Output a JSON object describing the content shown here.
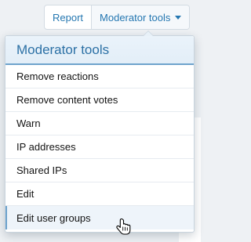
{
  "toolbar": {
    "report_label": "Report",
    "moderator_tools_label": "Moderator tools"
  },
  "menu": {
    "title": "Moderator tools",
    "items": [
      {
        "label": "Remove reactions"
      },
      {
        "label": "Remove content votes"
      },
      {
        "label": "Warn"
      },
      {
        "label": "IP addresses"
      },
      {
        "label": "Shared IPs"
      },
      {
        "label": "Edit"
      },
      {
        "label": "Edit user groups",
        "hovered": true
      }
    ]
  },
  "colors": {
    "accent": "#2577b1",
    "header_text": "#2b70a5",
    "header_bg": "#e3eef8",
    "header_border": "#6ea3cc",
    "page_bg": "#eef1f4"
  },
  "icons": {
    "dropdown": "caret-down-icon",
    "pointer": "hand-pointer-cursor-icon"
  }
}
